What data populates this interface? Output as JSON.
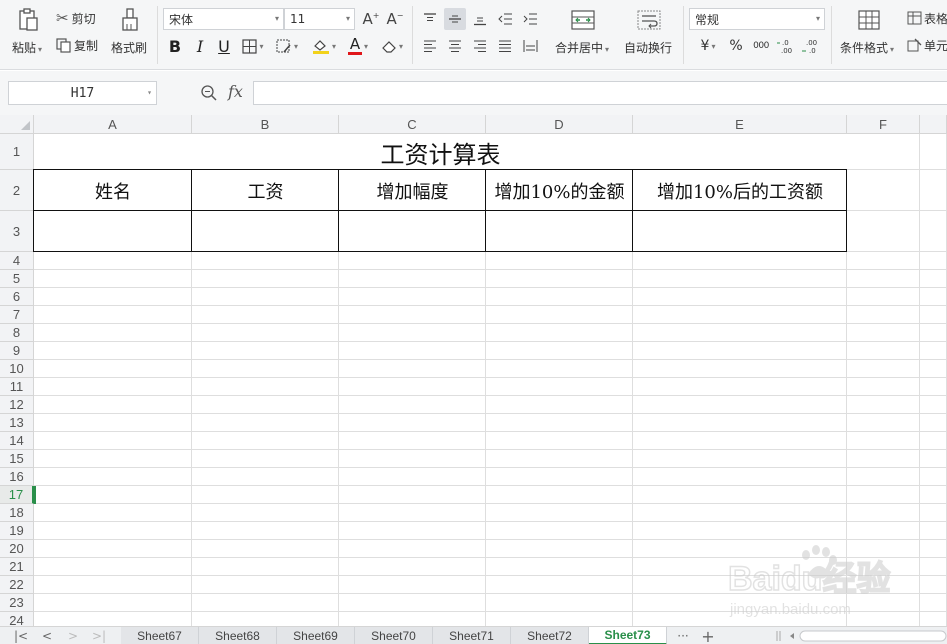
{
  "ribbon": {
    "paste": "粘贴",
    "cut": "剪切",
    "copy": "复制",
    "format_painter": "格式刷",
    "font_name": "宋体",
    "font_size": "11",
    "bold": "B",
    "italic": "I",
    "underline": "U",
    "font_color_letter": "A",
    "merge_center": "合并居中",
    "wrap_text": "自动换行",
    "number_format": "常规",
    "currency": "¥",
    "percent": "%",
    "thousands": "000",
    "inc_decimal": "+.0\n.00",
    "dec_decimal": ".00\n→.0",
    "cond_format": "条件格式",
    "table_style": "表格",
    "cell_style": "单元",
    "accent_color": "#2a8f4a"
  },
  "formula_bar": {
    "cell_ref": "H17",
    "fx": "fx",
    "formula": ""
  },
  "grid": {
    "columns": [
      "A",
      "B",
      "C",
      "D",
      "E",
      "F"
    ],
    "rows": [
      "1",
      "2",
      "3",
      "4",
      "5",
      "6",
      "7",
      "8",
      "9",
      "10",
      "11",
      "12",
      "13",
      "14",
      "15",
      "16",
      "17",
      "18",
      "19",
      "20",
      "21",
      "22",
      "23",
      "24"
    ],
    "selected_row": "17",
    "title": "工资计算表",
    "headers": [
      "姓名",
      "工资",
      "增加幅度",
      "增加10%的金额",
      "增加10%后的工资额"
    ]
  },
  "sheets": {
    "tabs": [
      "Sheet67",
      "Sheet68",
      "Sheet69",
      "Sheet70",
      "Sheet71",
      "Sheet72",
      "Sheet73"
    ],
    "active": "Sheet73",
    "more": "···",
    "add": "+"
  },
  "watermark": {
    "brand": "Baidu经验",
    "url": "jingyan.baidu.com"
  }
}
